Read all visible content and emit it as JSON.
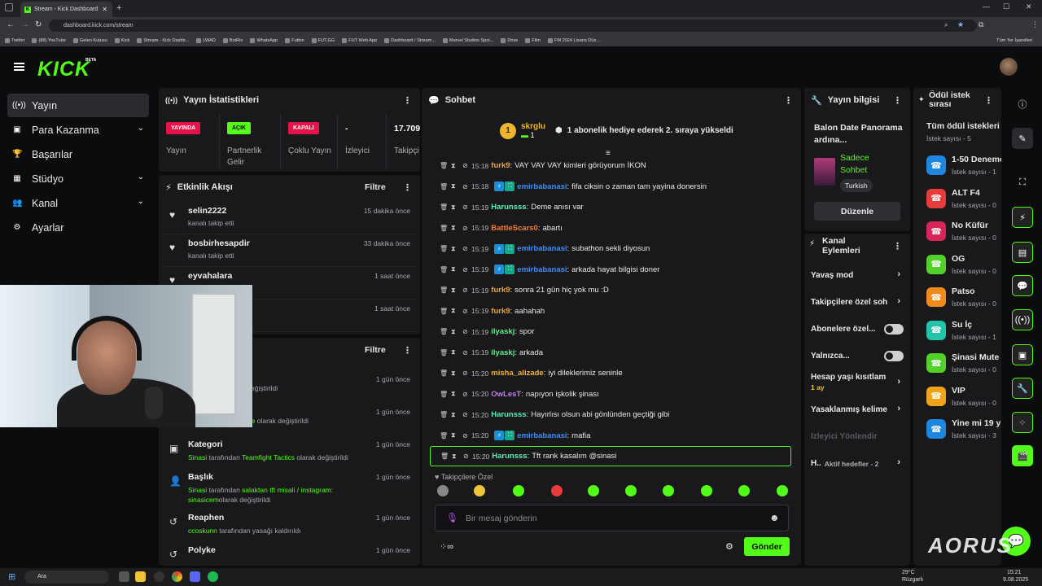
{
  "browser": {
    "tab_title": "Stream - Kick Dashboard",
    "url": "dashboard.kick.com/stream",
    "bookmarks": [
      "Twitter",
      "(88) YouTube",
      "Gelen Kutusu",
      "Kick",
      "Stream - Kick Dashb...",
      "LWAD",
      "BotRix",
      "WhatsApp",
      "Futbin",
      "FUT.GG",
      "FUT Web App",
      "Dashboard / Stream...",
      "Marvel Studios Spoi...",
      "Drive",
      "Film",
      "FM 2024 Lisans Düz..."
    ],
    "all_bookmarks": "Tüm Yer İşaretleri"
  },
  "app": {
    "logo": "KICK",
    "beta": "BETA"
  },
  "nav": [
    {
      "label": "Yayın",
      "icon": "broadcast-icon"
    },
    {
      "label": "Para Kazanma",
      "icon": "money-icon"
    },
    {
      "label": "Başarılar",
      "icon": "trophy-icon"
    },
    {
      "label": "Stüdyo",
      "icon": "studio-icon"
    },
    {
      "label": "Kanal",
      "icon": "users-icon"
    },
    {
      "label": "Ayarlar",
      "icon": "gear-icon"
    }
  ],
  "stats": {
    "title": "Yayın İstatistikleri",
    "items": [
      {
        "badge": "YAYINDA",
        "label": "Yayın",
        "color": "#e6134a"
      },
      {
        "badge": "AÇIK",
        "label": "Partnerlik Gelir",
        "color": "#53fc18"
      },
      {
        "badge": "KAPALI",
        "label": "Çoklu Yayın",
        "color": "#e6134a"
      },
      {
        "badge": "-",
        "label": "İzleyici"
      },
      {
        "badge": "17.709",
        "label": "Takipçi"
      }
    ]
  },
  "activity": {
    "title": "Etkinlik Akışı",
    "filter": "Filtre",
    "items": [
      {
        "name": "selin2222",
        "sub": "kanalı takip etti",
        "time": "15 dakika önce"
      },
      {
        "name": "bosbirhesapdir",
        "sub": "kanalı takip etti",
        "time": "33 dakika önce"
      },
      {
        "name": "eyvahalara",
        "sub": "",
        "time": "1 saat önce"
      },
      {
        "name": "",
        "sub": "",
        "time": "1 saat önce"
      }
    ]
  },
  "mod": {
    "filter": "Filtre",
    "items": [
      {
        "name": "",
        "pre": "",
        "hl": "Battlefield 6",
        "post": " olarak değiştirildi",
        "time": "1 gün önce"
      },
      {
        "name": "",
        "pre": "",
        "hl": "Call of Duty: Warzone",
        "post": " olarak değiştirildi",
        "time": "1 gün önce"
      },
      {
        "name": "Kategori",
        "pre": "Sinasi",
        "mid": " tarafından ",
        "hl": "Teamfight Tactics",
        "post": " olarak değiştirildi",
        "time": "1 gün önce"
      },
      {
        "name": "Başlık",
        "pre": "Sinasi",
        "mid": " tarafından ",
        "hl": "salaktan tft misali / instagram: sinasicem",
        "post": "olarak değiştirildi",
        "time": "1 gün önce"
      },
      {
        "name": "Reaphen",
        "pre": "ccoskunn",
        "mid": " tarafından yasağı kaldırıldı",
        "hl": "",
        "post": "",
        "time": "1 gün önce"
      },
      {
        "name": "Polyke",
        "pre": "",
        "hl": "",
        "post": "",
        "time": "1 gün önce"
      }
    ]
  },
  "chat": {
    "title": "Sohbet",
    "pinned_user": "skrglu",
    "pinned_count": "1",
    "pinned_msg": "1 abonelik hediye ederek 2. sıraya yükseldi",
    "messages": [
      {
        "time": "15:18",
        "user": "furk9",
        "color": "#f2a73b",
        "badges": 0,
        "msg": "VAY VAY VAY kimleri görüyorum İKON"
      },
      {
        "time": "15:18",
        "user": "emirbabanasi",
        "color": "#3d8ef7",
        "badges": 2,
        "msg": "fifa ciksin o zaman tam yayina donersin"
      },
      {
        "time": "15:19",
        "user": "Harunsss",
        "color": "#5cf0b5",
        "badges": 0,
        "msg": "Deme anısı var"
      },
      {
        "time": "15:19",
        "user": "BattleScars0",
        "color": "#f27e3b",
        "badges": 0,
        "msg": "abartı"
      },
      {
        "time": "15:19",
        "user": "emirbabanasi",
        "color": "#3d8ef7",
        "badges": 2,
        "msg": "subathon sekli diyosun"
      },
      {
        "time": "15:19",
        "user": "emirbabanasi",
        "color": "#3d8ef7",
        "badges": 2,
        "msg": "arkada hayat bilgisi doner"
      },
      {
        "time": "15:19",
        "user": "furk9",
        "color": "#f2a73b",
        "badges": 0,
        "msg": "sonra 21 gün hiç yok mu :D"
      },
      {
        "time": "15:19",
        "user": "furk9",
        "color": "#f2a73b",
        "badges": 0,
        "msg": "aahahah"
      },
      {
        "time": "15:19",
        "user": "ilyaskj",
        "color": "#5cf08c",
        "badges": 0,
        "msg": "spor"
      },
      {
        "time": "15:19",
        "user": "ilyaskj",
        "color": "#5cf08c",
        "badges": 0,
        "msg": "arkada"
      },
      {
        "time": "15:20",
        "user": "misha_alizade",
        "color": "#f2b33b",
        "badges": 0,
        "msg": "iyi dileklerimiz seninle"
      },
      {
        "time": "15:20",
        "user": "OwLesT",
        "color": "#c77df7",
        "badges": 0,
        "msg": "napıyon işkolik şinası"
      },
      {
        "time": "15:20",
        "user": "Harunsss",
        "color": "#5cf0b5",
        "badges": 0,
        "msg": "Hayırlısı olsun abi gönlünden geçtiği gibi"
      },
      {
        "time": "15:20",
        "user": "emirbabanasi",
        "color": "#3d8ef7",
        "badges": 2,
        "msg": "mafia"
      },
      {
        "time": "15:20",
        "user": "Harunsss",
        "color": "#5cf0b5",
        "badges": 0,
        "msg": "Tft rank kasalım @sinasi"
      }
    ],
    "followers_only": "Takipçilere Özel",
    "placeholder": "Bir mesaj gönderin",
    "send": "Gönder"
  },
  "stream_info": {
    "title": "Yayın bilgisi",
    "stream_title": "Balon Date Panorama ardına...",
    "mode": "Sadece Sohbet",
    "language": "Turkish",
    "edit": "Düzenle"
  },
  "channel_actions": {
    "title": "Kanal Eylemleri",
    "items": [
      {
        "label": "Yavaş mod",
        "kind": "chevron"
      },
      {
        "label": "Takipçilere özel soh",
        "kind": "chevron"
      },
      {
        "label": "Abonelere özel...",
        "kind": "toggle"
      },
      {
        "label": "Yalnızca...",
        "kind": "toggle"
      },
      {
        "label": "Hesap yaşı kısıtlam",
        "sub": "1 ay",
        "kind": "chevron"
      },
      {
        "label": "Yasaklanmış kelime",
        "kind": "chevron"
      },
      {
        "label": "İzleyici Yönlendir",
        "kind": "disabled"
      },
      {
        "label": "H..",
        "sub": "Aktif hedefler - 2",
        "kind": "chevron"
      }
    ]
  },
  "rewards": {
    "title": "Ödül istek sırası",
    "all": "Tüm ödül istekleri",
    "all_count": "İstek sayısı - 5",
    "items": [
      {
        "name": "1-50 Deneme",
        "count": "İstek sayısı - 1",
        "color": "#1f86e0"
      },
      {
        "name": "ALT F4",
        "count": "İstek sayısı - 0",
        "color": "#e83b3b"
      },
      {
        "name": "No Küfür",
        "count": "İstek sayısı - 0",
        "color": "#d9265a"
      },
      {
        "name": "OG",
        "count": "İstek sayısı - 0",
        "color": "#53d12a"
      },
      {
        "name": "Patso",
        "count": "İstek sayısı - 0",
        "color": "#f08a1a"
      },
      {
        "name": "Su İç",
        "count": "İstek sayısı - 1",
        "color": "#22c4a8"
      },
      {
        "name": "Şinasi Mute",
        "count": "İstek sayısı - 0",
        "color": "#53d12a"
      },
      {
        "name": "VIP",
        "count": "İstek sayısı - 0",
        "color": "#f0a31a"
      },
      {
        "name": "Yine mi 19 y",
        "count": "İstek sayısı - 3",
        "color": "#1f86e0"
      }
    ]
  },
  "taskbar": {
    "search": "Ara",
    "temp": "29°C",
    "weather": "Rüzgarlı",
    "time": "15:21",
    "date": "9.08.2025"
  },
  "brand": "AORUS"
}
